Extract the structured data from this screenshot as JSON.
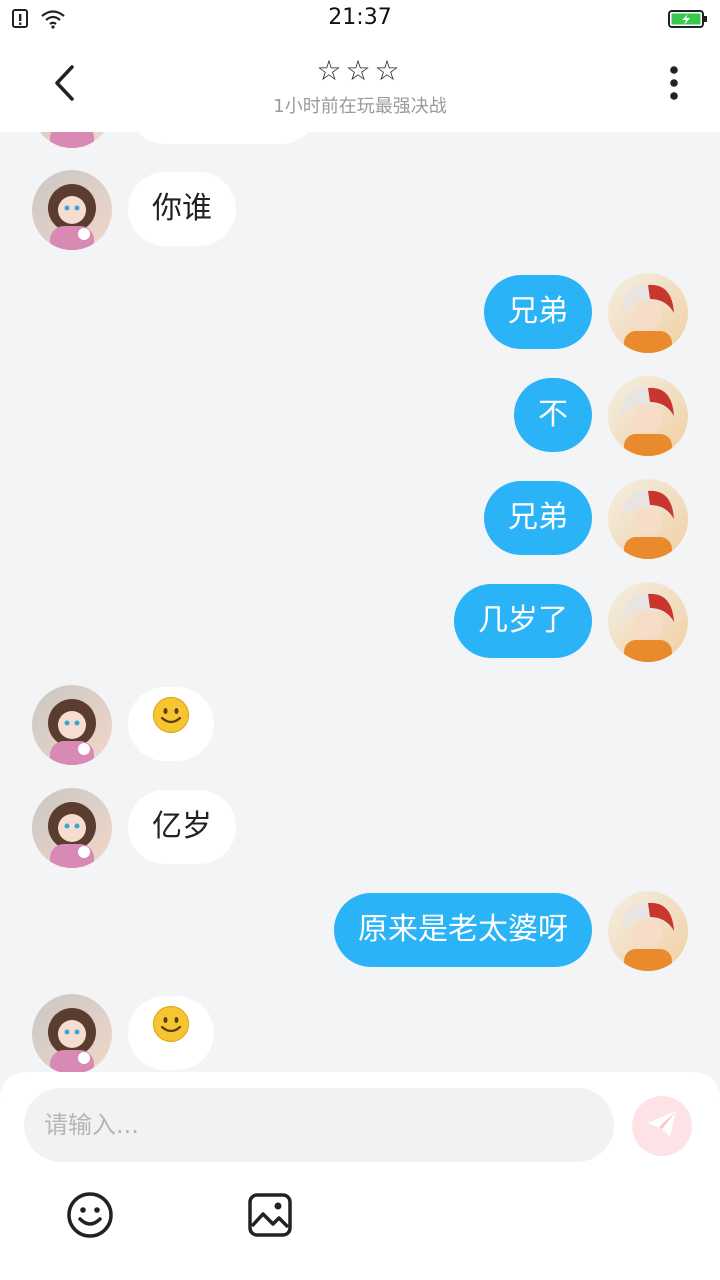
{
  "status_bar": {
    "time": "21:37",
    "icons": [
      "sim-alert-icon",
      "wifi-icon",
      "battery-charging-icon"
    ]
  },
  "header": {
    "title": "☆☆☆",
    "subtitle": "1小时前在玩最强决战",
    "back_icon": "chevron-left-icon",
    "more_icon": "more-vertical-icon"
  },
  "messages": [
    {
      "side": "left",
      "type": "text",
      "text": "你谁"
    },
    {
      "side": "right",
      "type": "text",
      "text": "兄弟"
    },
    {
      "side": "right",
      "type": "text",
      "text": "不"
    },
    {
      "side": "right",
      "type": "text",
      "text": "兄弟"
    },
    {
      "side": "right",
      "type": "text",
      "text": "几岁了"
    },
    {
      "side": "left",
      "type": "emoji",
      "text": "",
      "icon": "smiley-emoji-icon"
    },
    {
      "side": "left",
      "type": "text",
      "text": "亿岁"
    },
    {
      "side": "right",
      "type": "text",
      "text": "原来是老太婆呀"
    },
    {
      "side": "left",
      "type": "emoji",
      "text": "",
      "icon": "smiley-emoji-icon"
    }
  ],
  "composer": {
    "placeholder": "请输入...",
    "send_icon": "paper-plane-icon",
    "emoji_icon": "smiley-icon",
    "image_icon": "image-icon"
  },
  "colors": {
    "accent": "#2ab3f6",
    "background": "#f3f4f6",
    "send_button": "#fde3e6"
  }
}
